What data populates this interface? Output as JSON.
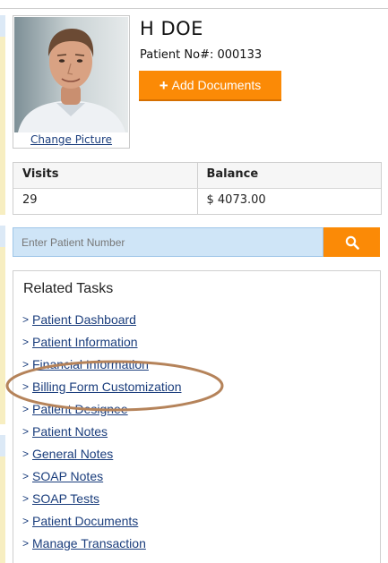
{
  "patient": {
    "name": "H DOE",
    "number_label": "Patient No#: 000133",
    "change_picture": "Change Picture"
  },
  "actions": {
    "add_documents": "Add Documents",
    "plus_icon": "+"
  },
  "stats": {
    "headers": [
      "Visits",
      "Balance"
    ],
    "values": [
      "29",
      "$ 4073.00"
    ]
  },
  "search": {
    "placeholder": "Enter Patient Number",
    "icon": "search-icon"
  },
  "related_tasks": {
    "title": "Related Tasks",
    "chevron": ">",
    "items": [
      "Patient Dashboard",
      "Patient Information",
      "Financial Information",
      "Billing Form Customization",
      "Patient Designee",
      "Patient Notes",
      "General Notes",
      "SOAP Notes",
      "SOAP Tests",
      "Patient Documents",
      "Manage Transaction"
    ],
    "highlighted_item": "Billing Form Customization"
  },
  "colors": {
    "accent_orange": "#fb8a06",
    "link_blue": "#1a3d7c",
    "search_bg": "#cfe5f7",
    "annotation_ellipse": "#b5835a"
  }
}
